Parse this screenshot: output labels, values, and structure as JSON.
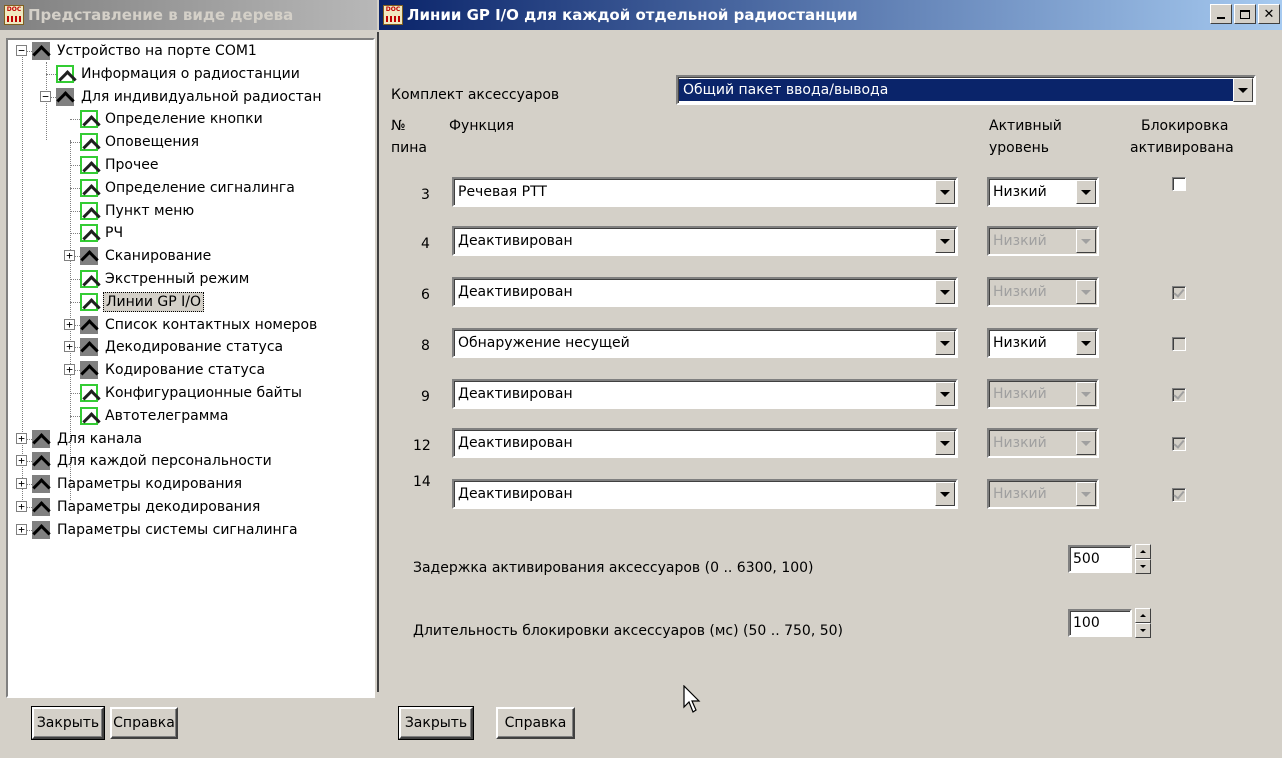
{
  "left_pane": {
    "title": "Представление в виде дерева",
    "tree": [
      {
        "label": "Устройство на порте COM1",
        "icon": "grey"
      },
      {
        "label": "Информация о радиостанции",
        "icon": "green"
      },
      {
        "label": "Для индивидуальной радиостан",
        "icon": "grey"
      },
      {
        "label": "Определение кнопки",
        "icon": "green"
      },
      {
        "label": "Оповещения",
        "icon": "green"
      },
      {
        "label": "Прочее",
        "icon": "green"
      },
      {
        "label": "Определение сигналинга",
        "icon": "green"
      },
      {
        "label": "Пункт меню",
        "icon": "green"
      },
      {
        "label": "РЧ",
        "icon": "green"
      },
      {
        "label": "Сканирование",
        "icon": "grey"
      },
      {
        "label": "Экстренный режим",
        "icon": "green"
      },
      {
        "label": "Линии GP I/O",
        "icon": "green",
        "selected": true
      },
      {
        "label": "Список контактных номеров",
        "icon": "grey"
      },
      {
        "label": "Декодирование статуса",
        "icon": "grey"
      },
      {
        "label": "Кодирование статуса",
        "icon": "grey"
      },
      {
        "label": "Конфигурационные байты",
        "icon": "green"
      },
      {
        "label": "Автотелеграмма",
        "icon": "green"
      },
      {
        "label": "Для канала",
        "icon": "grey"
      },
      {
        "label": "Для каждой персональности",
        "icon": "grey"
      },
      {
        "label": "Параметры кодирования",
        "icon": "grey"
      },
      {
        "label": "Параметры  декодирования",
        "icon": "grey"
      },
      {
        "label": "Параметры системы сигналинга",
        "icon": "grey"
      }
    ],
    "close_label": "Закрыть",
    "help_label": "Справка"
  },
  "right_pane": {
    "title": "Линии GP I/O для каждой отдельной радиостанции",
    "kit_label": "Комплект аксессуаров",
    "kit_value": "Общий пакет ввода/вывода",
    "col_pin_1": "№",
    "col_pin_2": "пина",
    "col_function": "Функция",
    "col_level_1": "Активный",
    "col_level_2": "уровень",
    "col_lock_1": "Блокировка",
    "col_lock_2": "активирована",
    "rows": [
      {
        "pin": "3",
        "function": "Речевая PTT",
        "level": "Низкий",
        "level_enabled": true,
        "lock_visible": true,
        "lock_checked": false,
        "lock_enabled": true
      },
      {
        "pin": "4",
        "function": "Деактивирован",
        "level": "Низкий",
        "level_enabled": false,
        "lock_visible": false,
        "lock_checked": false,
        "lock_enabled": false
      },
      {
        "pin": "6",
        "function": "Деактивирован",
        "level": "Низкий",
        "level_enabled": false,
        "lock_visible": true,
        "lock_checked": true,
        "lock_enabled": false
      },
      {
        "pin": "8",
        "function": "Обнаружение несущей",
        "level": "Низкий",
        "level_enabled": true,
        "lock_visible": true,
        "lock_checked": false,
        "lock_enabled": false
      },
      {
        "pin": "9",
        "function": "Деактивирован",
        "level": "Низкий",
        "level_enabled": false,
        "lock_visible": true,
        "lock_checked": true,
        "lock_enabled": false
      },
      {
        "pin": "12",
        "function": "Деактивирован",
        "level": "Низкий",
        "level_enabled": false,
        "lock_visible": true,
        "lock_checked": true,
        "lock_enabled": false
      },
      {
        "pin": "14",
        "function": "Деактивирован",
        "level": "Низкий",
        "level_enabled": false,
        "lock_visible": true,
        "lock_checked": true,
        "lock_enabled": false
      }
    ],
    "delay_label": "Задержка активирования аксессуаров (0 .. 6300, 100)",
    "delay_value": "500",
    "lock_duration_label": "Длительность блокировки аксессуаров (мс) (50 .. 750, 50)",
    "lock_duration_value": "100",
    "close_label": "Закрыть",
    "help_label": "Справка"
  }
}
